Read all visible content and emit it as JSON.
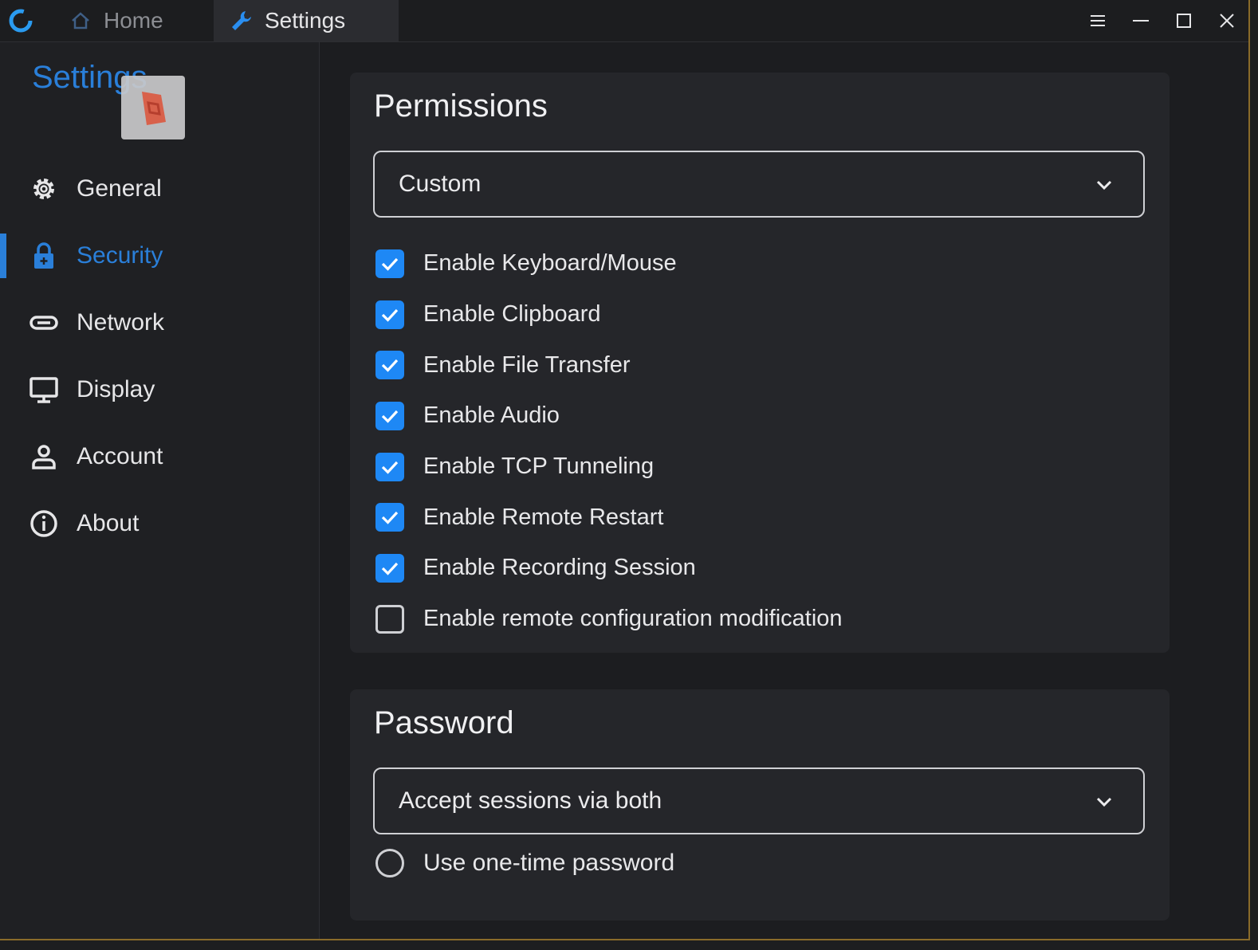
{
  "tabs": {
    "home": "Home",
    "settings": "Settings"
  },
  "sidebar": {
    "title": "Settings",
    "items": [
      {
        "label": "General",
        "icon": "gear-icon",
        "active": false
      },
      {
        "label": "Security",
        "icon": "lock-icon",
        "active": true
      },
      {
        "label": "Network",
        "icon": "link-icon",
        "active": false
      },
      {
        "label": "Display",
        "icon": "monitor-icon",
        "active": false
      },
      {
        "label": "Account",
        "icon": "user-icon",
        "active": false
      },
      {
        "label": "About",
        "icon": "info-icon",
        "active": false
      }
    ]
  },
  "permissions": {
    "title": "Permissions",
    "selected": "Custom",
    "options": [
      {
        "label": "Enable Keyboard/Mouse",
        "checked": true
      },
      {
        "label": "Enable Clipboard",
        "checked": true
      },
      {
        "label": "Enable File Transfer",
        "checked": true
      },
      {
        "label": "Enable Audio",
        "checked": true
      },
      {
        "label": "Enable TCP Tunneling",
        "checked": true
      },
      {
        "label": "Enable Remote Restart",
        "checked": true
      },
      {
        "label": "Enable Recording Session",
        "checked": true
      },
      {
        "label": "Enable remote configuration modification",
        "checked": false
      }
    ]
  },
  "password": {
    "title": "Password",
    "selected": "Accept sessions via both",
    "one_time_label": "Use one-time password",
    "one_time_selected": false
  },
  "colors": {
    "accent": "#2a7fd9",
    "checkbox": "#1e88f5",
    "background": "#1f2023",
    "card": "#25262a"
  }
}
